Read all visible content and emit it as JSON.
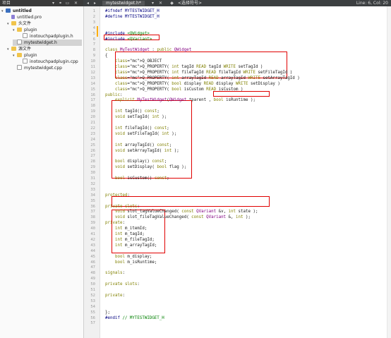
{
  "topbar": {
    "project_label": "项目",
    "open_file": "mytestwidget.h*",
    "symbol": "<选择符号>",
    "position": "Line: 6, Col: 20"
  },
  "tree": [
    {
      "label": "untitled",
      "type": "proj",
      "level": 0,
      "expanded": true,
      "bold": true
    },
    {
      "label": "untitled.pro",
      "type": "pro",
      "level": 1
    },
    {
      "label": "头文件",
      "type": "fold",
      "level": 1,
      "expanded": true
    },
    {
      "label": "plugin",
      "type": "fold",
      "level": 2,
      "expanded": true
    },
    {
      "label": "inotouchpadplugin.h",
      "type": "hdr",
      "level": 3
    },
    {
      "label": "mytestwidget.h",
      "type": "hdr",
      "level": 2,
      "selected": true
    },
    {
      "label": "源文件",
      "type": "fold",
      "level": 1,
      "expanded": true
    },
    {
      "label": "plugin",
      "type": "fold",
      "level": 2,
      "expanded": true
    },
    {
      "label": "inotouchpadplugin.cpp",
      "type": "cpp",
      "level": 3
    },
    {
      "label": "mytestwidget.cpp",
      "type": "cpp",
      "level": 2
    }
  ],
  "code_lines": [
    "#ifndef MYTESTWIDGET_H",
    "#define MYTESTWIDGET_H",
    "",
    "",
    "#include <QWidget>",
    "#include <QVariant>",
    "",
    "class MyTestWidget : public QWidget",
    "{",
    "    Q_OBJECT",
    "    Q_PROPERTY( int tagId READ tagId WRITE setTagId )",
    "    Q_PROPERTY( int fileTagId READ fileTagId WRITE setFileTagId )",
    "    Q_PROPERTY( int arrayTagId READ arrayTagId WRITE setArrayTagId )",
    "    Q_PROPERTY( bool display READ display WRITE setDisplay )",
    "    Q_PROPERTY( bool isCustom READ isCustom )",
    "public:",
    "    explicit MyTestWidget(QWidget *parent , bool isRuntime );",
    "",
    "    int tagId() const;",
    "    void setTagId( int );",
    "",
    "    int fileTagId() const;",
    "    void setFileTagId( int );",
    "",
    "    int arrayTagId() const;",
    "    void setArrayTagId( int );",
    "",
    "    bool display() const;",
    "    void setDisplay( bool flag );",
    "",
    "    bool isCustom() const;",
    "",
    "",
    "protected:",
    "",
    "private slots:",
    "    void slot_tagValueChanged( const QVariant &v, int state );",
    "    void slot_fileTagValueChanged( const QVariant &, int );",
    "private:",
    "    int m_itemId;",
    "    int m_tagId;",
    "    int m_fileTagId;",
    "    int m_arrayTagId;",
    "",
    "    bool m_display;",
    "    bool m_isRuntime;",
    "",
    "signals:",
    "",
    "private slots:",
    "",
    "private:",
    "",
    "",
    "};",
    "#endif // MYTESTWIDGET_H",
    ""
  ],
  "line_count": 57,
  "colors": {
    "highlight_box": "#e00000",
    "keyword": "#808000",
    "type": "#800080",
    "macro": "#000080",
    "comment": "#008000"
  }
}
